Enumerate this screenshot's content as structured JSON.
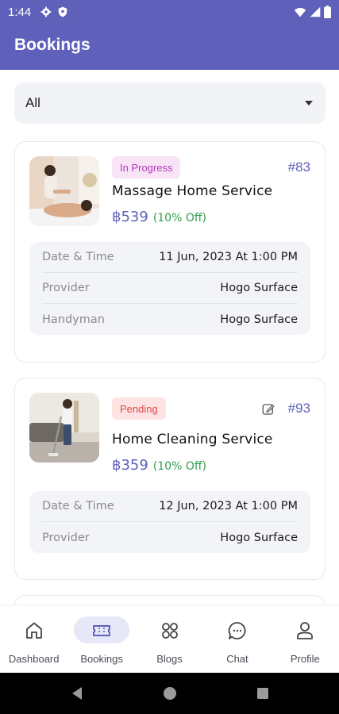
{
  "status_bar": {
    "time": "1:44"
  },
  "app_bar": {
    "title": "Bookings"
  },
  "filter": {
    "selected": "All"
  },
  "bookings": [
    {
      "status": "In Progress",
      "id": "#83",
      "service": "Massage Home Service",
      "price": "฿539",
      "discount": "(10% Off)",
      "details": [
        {
          "label": "Date & Time",
          "value": "11 Jun, 2023 At 1:00 PM"
        },
        {
          "label": "Provider",
          "value": "Hogo Surface"
        },
        {
          "label": "Handyman",
          "value": "Hogo Surface"
        }
      ]
    },
    {
      "status": "Pending",
      "id": "#93",
      "service": "Home Cleaning Service",
      "price": "฿359",
      "discount": "(10% Off)",
      "details": [
        {
          "label": "Date & Time",
          "value": "12 Jun, 2023 At 1:00 PM"
        },
        {
          "label": "Provider",
          "value": "Hogo Surface"
        }
      ]
    }
  ],
  "bottom_nav": {
    "items": [
      {
        "label": "Dashboard",
        "icon": "home-icon"
      },
      {
        "label": "Bookings",
        "icon": "ticket-icon",
        "active": true
      },
      {
        "label": "Blogs",
        "icon": "grid-icon"
      },
      {
        "label": "Chat",
        "icon": "chat-icon"
      },
      {
        "label": "Profile",
        "icon": "person-icon"
      }
    ]
  },
  "colors": {
    "primary": "#5f60b9",
    "in_progress": "#b03ab8",
    "pending": "#e04848",
    "discount": "#2e9e4a"
  }
}
